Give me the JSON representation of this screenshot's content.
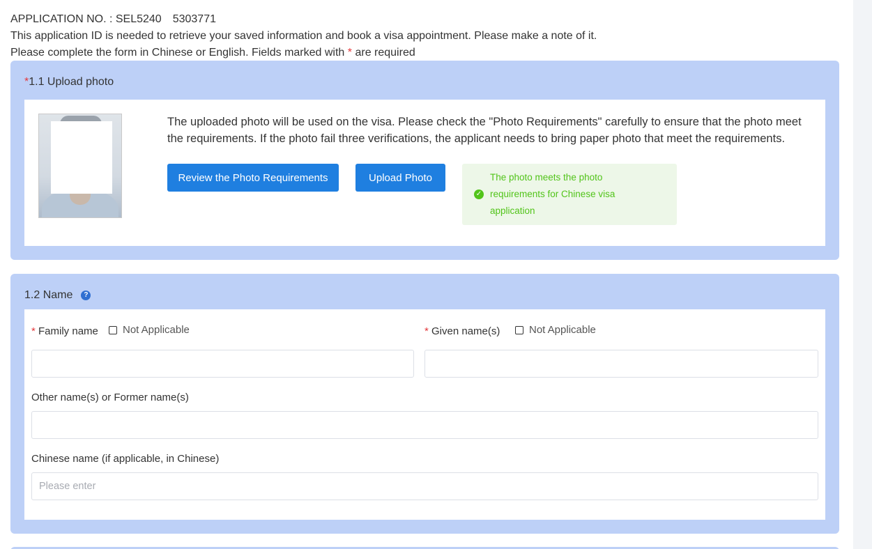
{
  "header": {
    "application_no": "APPLICATION NO. : SEL5240     5303771",
    "note": "This application ID is needed to retrieve your saved information and book a visa appointment. Please make a note of it.",
    "instruction_prefix": "Please complete the form in Chinese or English. Fields marked with ",
    "required_mark": "*",
    "instruction_suffix": " are required"
  },
  "photo_section": {
    "required_mark": "*",
    "title": "1.1 Upload photo",
    "description": "The uploaded photo will be used on the visa. Please check the \"Photo Requirements\" carefully to ensure that the photo meet the requirements. If the photo fail three verifications, the applicant needs to bring paper photo that meet the requirements.",
    "review_button": "Review the Photo Requirements",
    "upload_button": "Upload Photo",
    "status_message": "The photo meets the photo requirements for Chinese visa application",
    "status_icon": "check-circle-icon"
  },
  "name_section": {
    "title": "1.2 Name",
    "help_icon": "question-circle-icon",
    "family_name": {
      "required_mark": "*",
      "label": "Family name",
      "not_applicable": "Not Applicable",
      "value": ""
    },
    "given_name": {
      "required_mark": "*",
      "label": "Given name(s)",
      "not_applicable": "Not Applicable",
      "value": ""
    },
    "other_name": {
      "label": "Other name(s) or Former name(s)",
      "value": ""
    },
    "chinese_name": {
      "label": "Chinese name (if applicable, in Chinese)",
      "placeholder": "Please enter"
    }
  },
  "colors": {
    "section_bg": "#bdd0f7",
    "primary_button": "#1f7fe0",
    "success_text": "#52c41a",
    "success_bg": "#edf7e8",
    "required": "#e4393c"
  }
}
